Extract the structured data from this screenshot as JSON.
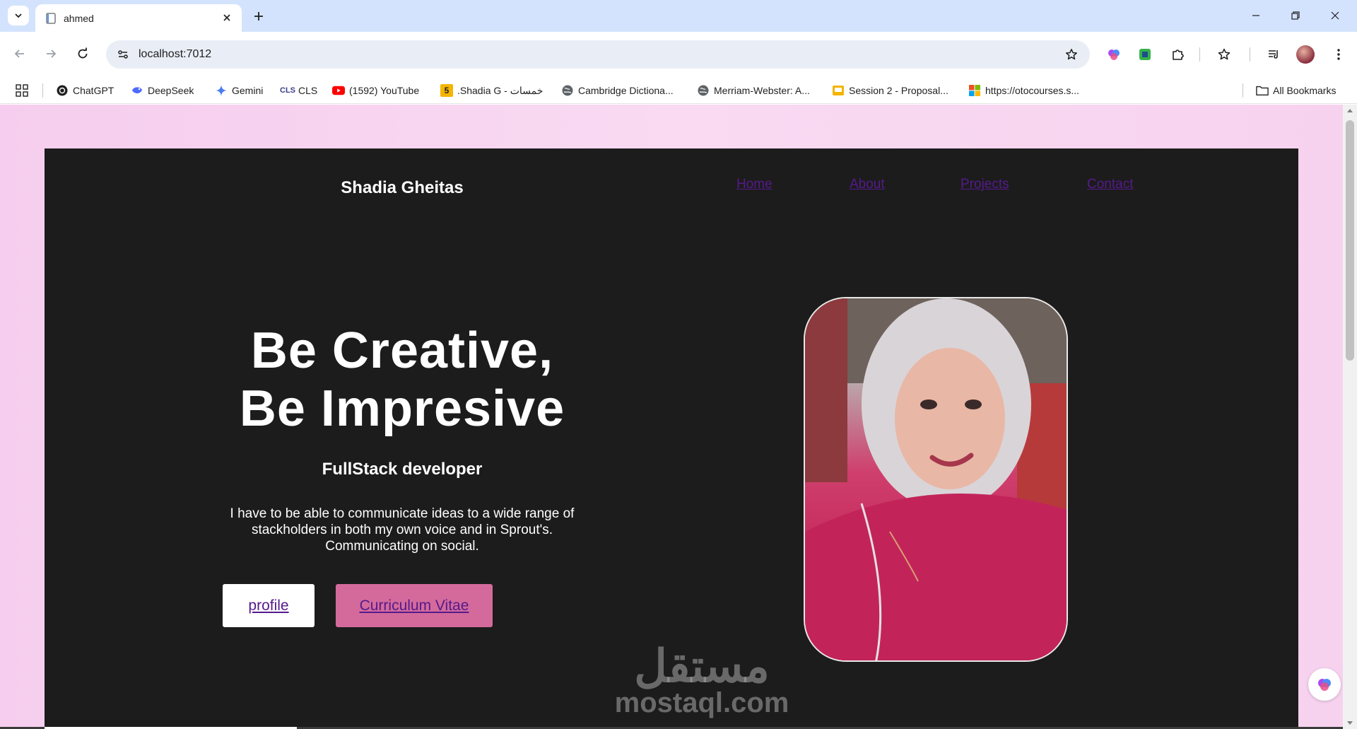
{
  "browser": {
    "tab_title": "ahmed",
    "url": "localhost:7012",
    "bookmarks": [
      {
        "label": "ChatGPT",
        "icon": "chatgpt-icon"
      },
      {
        "label": "DeepSeek",
        "icon": "deepseek-icon"
      },
      {
        "label": "Gemini",
        "icon": "gemini-icon"
      },
      {
        "label": "CLS",
        "icon": "cls-icon"
      },
      {
        "label": "(1592) YouTube",
        "icon": "youtube-icon"
      },
      {
        "label": ".Shadia G - خمسات",
        "icon": "khamsat-icon"
      },
      {
        "label": "Cambridge Dictiona...",
        "icon": "globe-icon"
      },
      {
        "label": "Merriam-Webster: A...",
        "icon": "globe-icon"
      },
      {
        "label": "Session 2 - Proposal...",
        "icon": "slides-icon"
      },
      {
        "label": "https://otocourses.s...",
        "icon": "microsoft-icon"
      }
    ],
    "all_bookmarks_label": "All Bookmarks"
  },
  "site": {
    "brand": "Shadia Gheitas",
    "nav": [
      "Home",
      "About",
      "Projects",
      "Contact"
    ],
    "hero": {
      "title_line1": "Be Creative,",
      "title_line2": "Be Impresive",
      "subtitle": "FullStack developer",
      "description_line1": "I have to be able to communicate ideas to a wide range of",
      "description_line2": "stackholders in both my own voice and in Sprout's.",
      "description_line3": "Communicating on social.",
      "profile_button": "profile",
      "cv_button": "Curriculum Vitae"
    },
    "watermark_ar": "مستقل",
    "watermark_en": "mostaql.com"
  },
  "colors": {
    "chrome_tabstrip": "#d3e3fd",
    "page_background": "#f6cdee",
    "card_background": "#1c1c1c",
    "link": "#551a8b",
    "cv_button": "#d46a9c"
  }
}
